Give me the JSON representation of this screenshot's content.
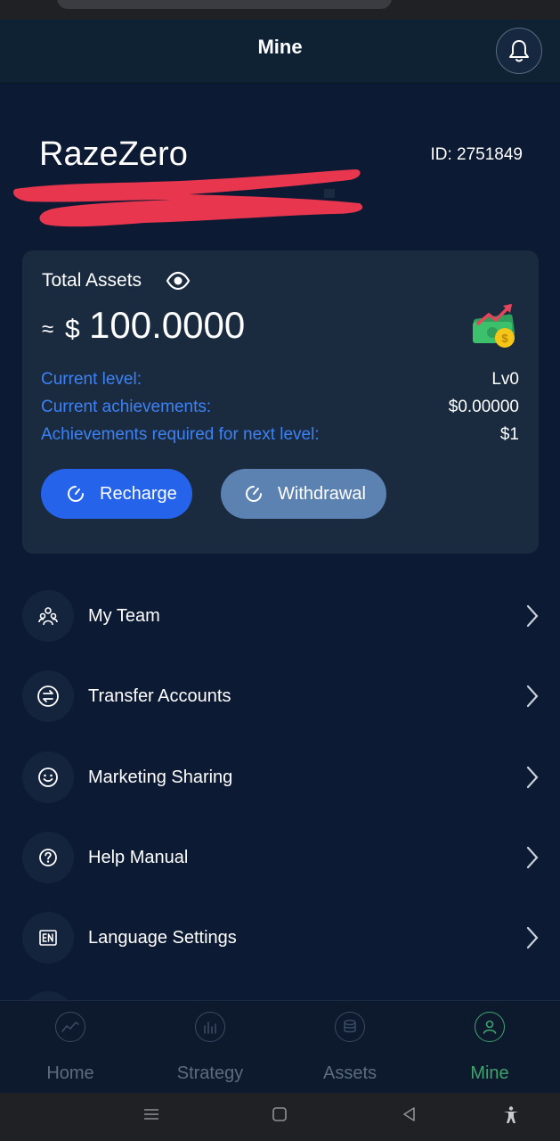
{
  "header": {
    "title": "Mine"
  },
  "profile": {
    "name": "RazeZero",
    "id": "ID: 2751849"
  },
  "assets": {
    "label": "Total Assets",
    "approx": "≈",
    "currency": "$",
    "amount": "100.0000",
    "stats": [
      {
        "label": "Current level:",
        "value": "Lv0"
      },
      {
        "label": "Current achievements:",
        "value": "$0.00000"
      },
      {
        "label": "Achievements required for next level:",
        "value": "$1"
      }
    ],
    "recharge_label": "Recharge",
    "withdraw_label": "Withdrawal"
  },
  "menu": [
    {
      "label": "My Team",
      "icon": "team-icon"
    },
    {
      "label": "Transfer Accounts",
      "icon": "transfer-icon"
    },
    {
      "label": "Marketing Sharing",
      "icon": "smile-icon"
    },
    {
      "label": "Help Manual",
      "icon": "help-icon"
    },
    {
      "label": "Language Settings",
      "icon": "language-icon"
    }
  ],
  "nav": [
    {
      "label": "Home",
      "icon": "home-chart-icon"
    },
    {
      "label": "Strategy",
      "icon": "strategy-icon"
    },
    {
      "label": "Assets",
      "icon": "assets-coins-icon"
    },
    {
      "label": "Mine",
      "icon": "user-icon",
      "active": true
    }
  ],
  "colors": {
    "background": "#0d1a33",
    "card": "#1a2b40",
    "accent_blue": "#2563eb",
    "link_blue": "#3d82f5",
    "active_green": "#3fa36b",
    "redaction": "#e8364f"
  }
}
